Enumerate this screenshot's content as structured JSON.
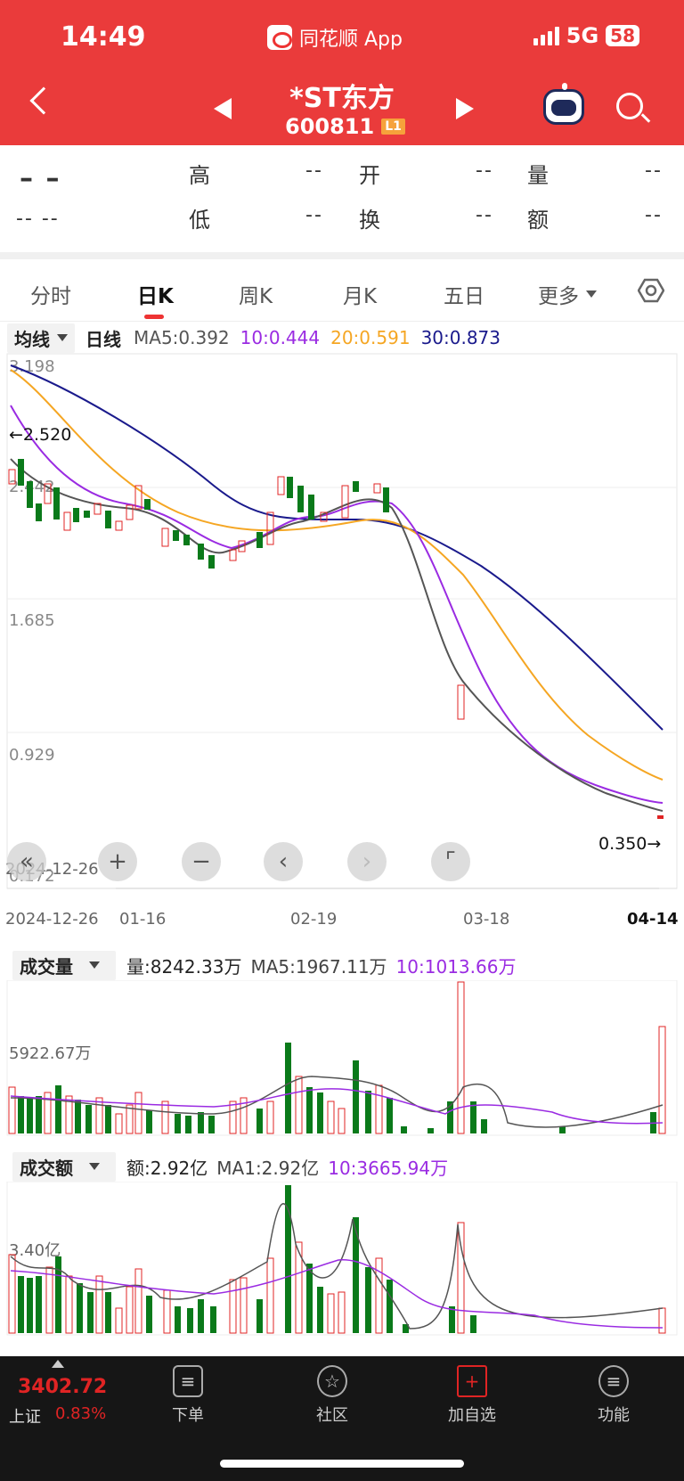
{
  "status_bar": {
    "time": "14:49",
    "app": "同花顺 App",
    "network": "5G",
    "battery": "58"
  },
  "header": {
    "stock_name": "*ST东方",
    "stock_code": "600811",
    "level_badge": "L1"
  },
  "quote": {
    "price": "– –",
    "change": "-- --",
    "high_label": "高",
    "high_value": "--",
    "low_label": "低",
    "low_value": "--",
    "open_label": "开",
    "open_value": "--",
    "turnover_label": "换",
    "turnover_value": "--",
    "volume_label": "量",
    "volume_value": "--",
    "amount_label": "额",
    "amount_value": "--"
  },
  "tabs": [
    {
      "label": "分时"
    },
    {
      "label": "日K"
    },
    {
      "label": "周K"
    },
    {
      "label": "月K"
    },
    {
      "label": "五日"
    },
    {
      "label": "更多"
    }
  ],
  "ma_bar": {
    "selector": "均线",
    "period": "日线",
    "ma5": "MA5:0.392",
    "ma10": "10:0.444",
    "ma20": "20:0.591",
    "ma30": "30:0.873"
  },
  "colors": {
    "up": "#e02424",
    "down": "#0a7a1a",
    "ma5": "#555555",
    "ma10": "#9a2be2",
    "ma20": "#f5a623",
    "ma30": "#1a1a8c",
    "header": "#ea3b3b"
  },
  "kline": {
    "y_labels": [
      "3.198",
      "2.442",
      "1.685",
      "0.929",
      "0.172"
    ],
    "max_marker": "←2.520",
    "min_marker": "0.350→",
    "x_labels": [
      "2024-12-26",
      "01-16",
      "02-19",
      "03-18",
      "04-14"
    ],
    "buttons": [
      "zoom-out-all",
      "zoom-in",
      "zoom-out",
      "prev",
      "next",
      "fullscreen"
    ]
  },
  "volume_panel": {
    "selector": "成交量",
    "value": "量:8242.33万",
    "ma5": "MA5:1967.11万",
    "ma10": "10:1013.66万",
    "y_label": "5922.67万"
  },
  "amount_panel": {
    "selector": "成交额",
    "value": "额:2.92亿",
    "ma1": "MA1:2.92亿",
    "ma10": "10:3665.94万",
    "y_label": "3.40亿"
  },
  "bottom_nav": {
    "index_value": "3402.72",
    "index_name": "上证",
    "index_change": "0.83%",
    "items": [
      {
        "label": "下单"
      },
      {
        "label": "社区"
      },
      {
        "label": "加自选"
      },
      {
        "label": "功能"
      }
    ]
  }
}
